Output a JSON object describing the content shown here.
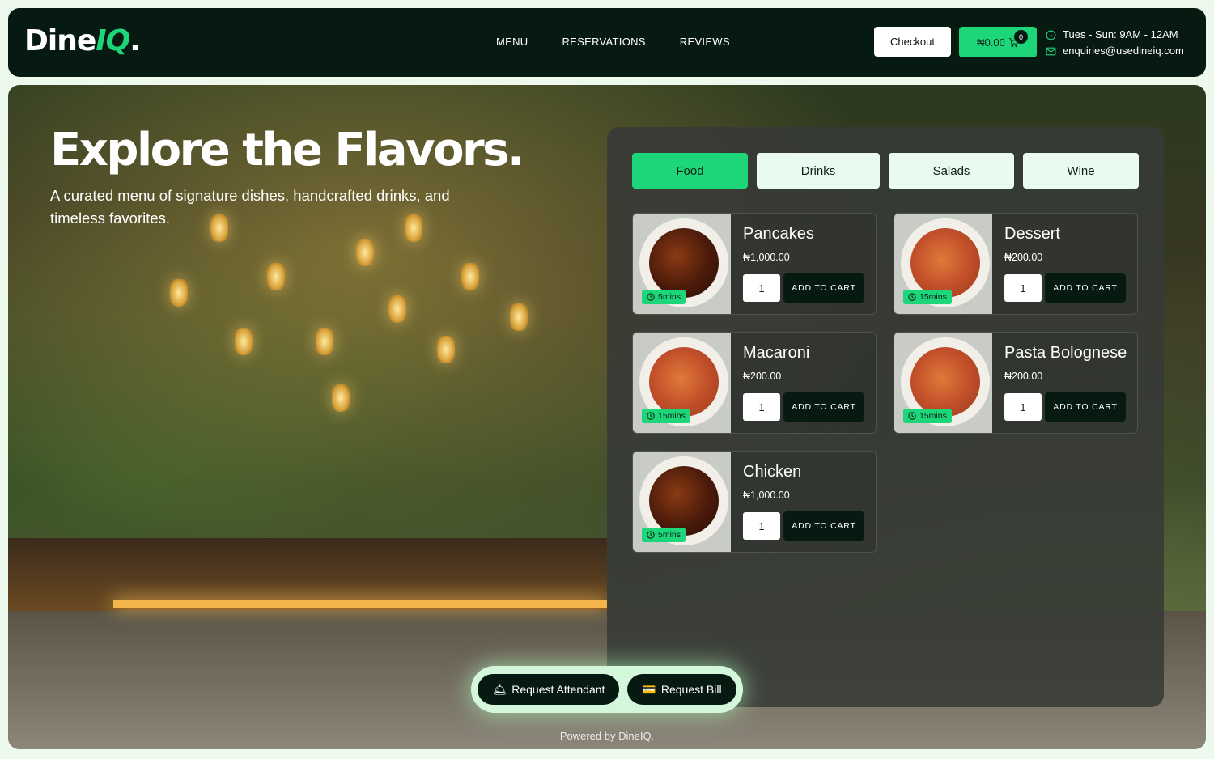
{
  "header": {
    "logo_main": "Dine",
    "logo_accent": "IQ",
    "logo_dot": ".",
    "nav": [
      "MENU",
      "RESERVATIONS",
      "REVIEWS"
    ],
    "checkout_label": "Checkout",
    "cart_total": "₦0.00",
    "cart_count": "0",
    "hours": "Tues - Sun: 9AM - 12AM",
    "email": "enquiries@usedineiq.com"
  },
  "hero": {
    "title": "Explore the Flavors.",
    "subtitle": "A curated menu of signature dishes, handcrafted drinks, and timeless favorites."
  },
  "menu": {
    "tabs": [
      {
        "label": "Food",
        "active": true
      },
      {
        "label": "Drinks",
        "active": false
      },
      {
        "label": "Salads",
        "active": false
      },
      {
        "label": "Wine",
        "active": false
      }
    ],
    "items": [
      {
        "name": "Pancakes",
        "price": "₦1,000.00",
        "time": "5mins",
        "qty": "1",
        "image": "chicken",
        "button": "ADD TO CART"
      },
      {
        "name": "Dessert",
        "price": "₦200.00",
        "time": "15mins",
        "qty": "1",
        "image": "pasta",
        "button": "ADD TO CART"
      },
      {
        "name": "Macaroni",
        "price": "₦200.00",
        "time": "15mins",
        "qty": "1",
        "image": "pasta",
        "button": "ADD TO CART"
      },
      {
        "name": "Pasta Bolognese",
        "price": "₦200.00",
        "time": "15mins",
        "qty": "1",
        "image": "pasta",
        "button": "ADD TO CART"
      },
      {
        "name": "Chicken",
        "price": "₦1,000.00",
        "time": "5mins",
        "qty": "1",
        "image": "chicken",
        "button": "ADD TO CART"
      }
    ]
  },
  "actions": {
    "attendant_icon": "🛎",
    "attendant_label": "Request Attendant",
    "bill_icon": "💳",
    "bill_label": "Request Bill"
  },
  "footer": {
    "powered": "Powered by DineIQ."
  },
  "colors": {
    "brand_dark": "#061a12",
    "accent": "#1ed67a"
  }
}
